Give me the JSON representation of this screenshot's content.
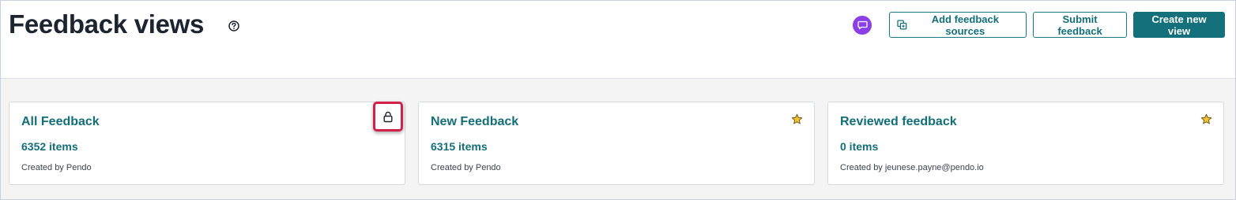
{
  "page": {
    "title": "Feedback views"
  },
  "header": {
    "icons": {
      "help": "question-circle-icon",
      "chat": "chat-bubble-icon",
      "add_sources": "copy-stack-icon"
    },
    "actions": {
      "add_sources_label": "Add feedback sources",
      "submit_label": "Submit feedback",
      "create_label": "Create new view"
    }
  },
  "views": [
    {
      "title": "All Feedback",
      "count": "6352 items",
      "created_by": "Created by Pendo",
      "icon": "lock-icon",
      "highlighted": true
    },
    {
      "title": "New Feedback",
      "count": "6315 items",
      "created_by": "Created by Pendo",
      "icon": "star-icon"
    },
    {
      "title": "Reviewed feedback",
      "count": "0 items",
      "created_by": "Created by jeunese.payne@pendo.io",
      "icon": "star-icon"
    }
  ],
  "colors": {
    "accent": "#14707b",
    "chat_badge": "#8c3fe6",
    "highlight": "#d0214b",
    "star": "#e6a817"
  }
}
